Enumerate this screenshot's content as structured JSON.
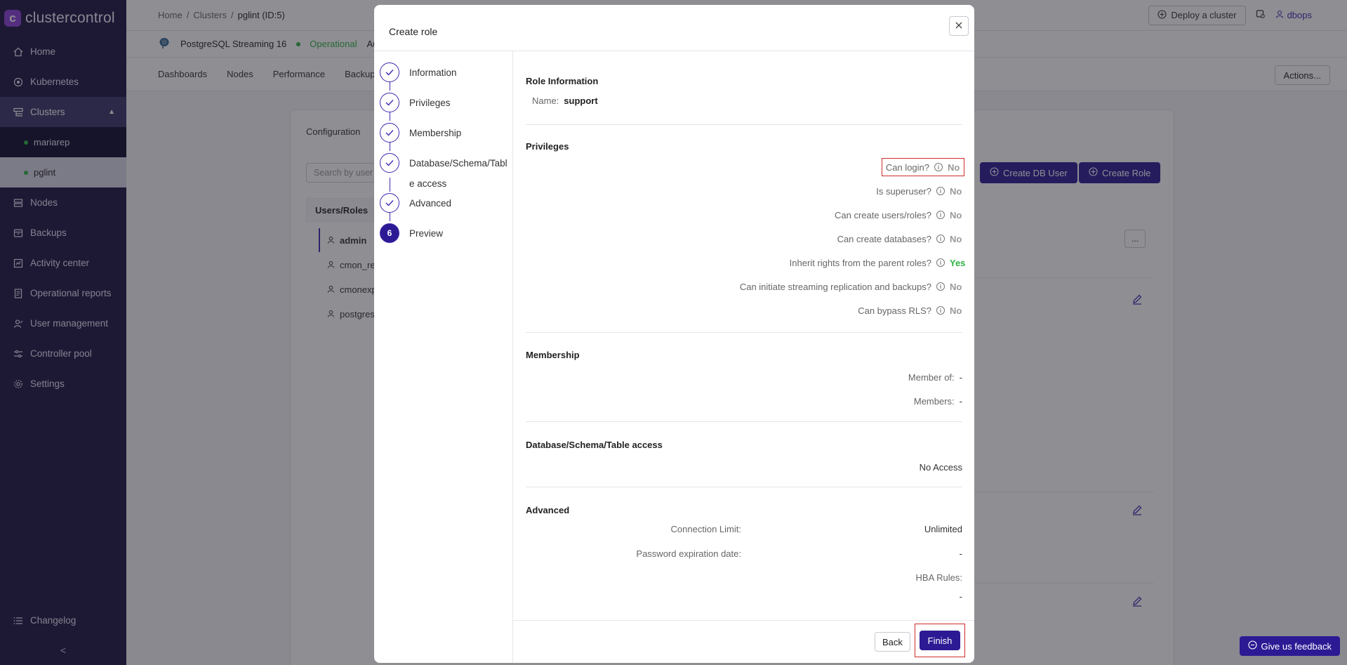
{
  "app": {
    "logo_text": "clustercontrol",
    "logo_letter": "c"
  },
  "sidebar": {
    "items": [
      {
        "label": "Home",
        "icon": "home-icon"
      },
      {
        "label": "Kubernetes",
        "icon": "kubernetes-icon"
      },
      {
        "label": "Clusters",
        "icon": "clusters-icon"
      },
      {
        "label": "Nodes",
        "icon": "nodes-icon"
      },
      {
        "label": "Backups",
        "icon": "backups-icon"
      },
      {
        "label": "Activity center",
        "icon": "activity-icon"
      },
      {
        "label": "Operational reports",
        "icon": "reports-icon"
      },
      {
        "label": "User management",
        "icon": "users-icon"
      },
      {
        "label": "Controller pool",
        "icon": "pool-icon"
      },
      {
        "label": "Settings",
        "icon": "gear-icon"
      }
    ],
    "clusters": [
      {
        "label": "mariarep"
      },
      {
        "label": "pglint"
      }
    ],
    "changelog": "Changelog",
    "collapse": "<"
  },
  "topbar": {
    "breadcrumb": [
      "Home",
      "/",
      "Clusters",
      "/",
      "pglint (ID:5)"
    ],
    "deploy": "Deploy a cluster",
    "user": "dbops"
  },
  "cluster": {
    "name": "PostgreSQL Streaming 16",
    "status": "Operational",
    "extra": "Au"
  },
  "tabs": [
    "Dashboards",
    "Nodes",
    "Performance",
    "Backups"
  ],
  "actions": "Actions...",
  "background": {
    "configuration": "Configuration",
    "search_placeholder": "Search by user",
    "users_title": "Users/Roles",
    "users": [
      "admin",
      "cmon_re",
      "cmonexp",
      "postgres"
    ],
    "create_db_user": "Create DB User",
    "create_role": "Create Role",
    "more": "..."
  },
  "modal": {
    "title": "Create role",
    "steps": [
      {
        "label": "Information"
      },
      {
        "label": "Privileges"
      },
      {
        "label": "Membership"
      },
      {
        "label": "Database/Schema/Table access"
      },
      {
        "label": "Advanced"
      },
      {
        "label": "Preview",
        "number": "6"
      }
    ],
    "role_info": {
      "title": "Role Information",
      "name_label": "Name:",
      "name_value": "support"
    },
    "privileges": {
      "title": "Privileges",
      "rows": [
        {
          "label": "Can login?",
          "value": "No"
        },
        {
          "label": "Is superuser?",
          "value": "No"
        },
        {
          "label": "Can create users/roles?",
          "value": "No"
        },
        {
          "label": "Can create databases?",
          "value": "No"
        },
        {
          "label": "Inherit rights from the parent roles?",
          "value": "Yes"
        },
        {
          "label": "Can initiate streaming replication and backups?",
          "value": "No"
        },
        {
          "label": "Can bypass RLS?",
          "value": "No"
        }
      ]
    },
    "membership": {
      "title": "Membership",
      "member_of_label": "Member of:",
      "member_of_value": "-",
      "members_label": "Members:",
      "members_value": "-"
    },
    "access": {
      "title": "Database/Schema/Table access",
      "value": "No Access"
    },
    "advanced": {
      "title": "Advanced",
      "connection_limit_label": "Connection Limit:",
      "connection_limit_value": "Unlimited",
      "password_exp_label": "Password expiration date:",
      "password_exp_value": "-",
      "hba_label": "HBA Rules:",
      "hba_value": "-"
    },
    "back": "Back",
    "finish": "Finish"
  },
  "feedback": "Give us feedback",
  "colors": {
    "brand": "#2c1a94",
    "sidebar": "#1c1443",
    "success": "#2fb344",
    "highlight": "#d12b2b"
  }
}
